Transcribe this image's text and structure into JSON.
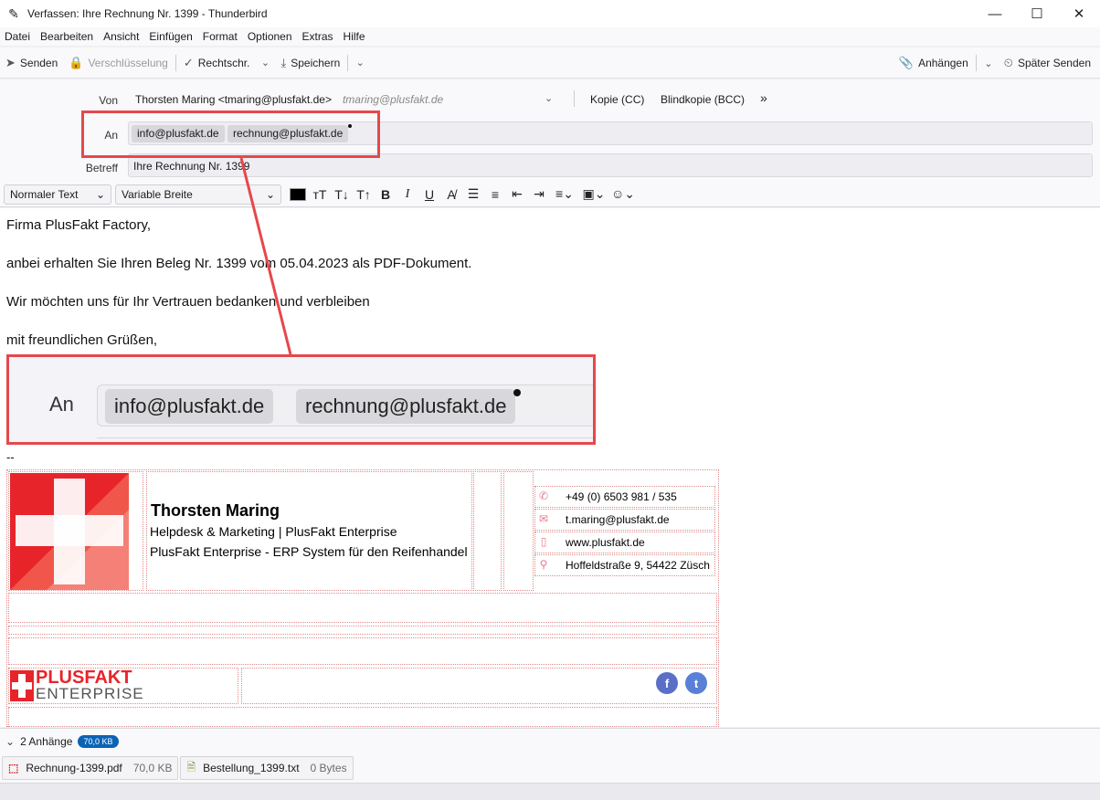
{
  "window": {
    "title": "Verfassen: Ihre Rechnung Nr. 1399 - Thunderbird",
    "minimize": "—",
    "maximize": "☐",
    "close": "✕"
  },
  "menu": [
    "Datei",
    "Bearbeiten",
    "Ansicht",
    "Einfügen",
    "Format",
    "Optionen",
    "Extras",
    "Hilfe"
  ],
  "toolbar": {
    "send": "Senden",
    "encryption": "Verschlüsselung",
    "spellcheck": "Rechtschr.",
    "save": "Speichern",
    "attach": "Anhängen",
    "send_later": "Später Senden"
  },
  "header": {
    "from_label": "Von",
    "from_value": "Thorsten Maring <tmaring@plusfakt.de>",
    "from_alt": "tmaring@plusfakt.de",
    "cc": "Kopie (CC)",
    "bcc": "Blindkopie (BCC)",
    "more": "»",
    "to_label": "An",
    "recipients": [
      "info@plusfakt.de",
      "rechnung@plusfakt.de"
    ],
    "subject_label": "Betreff",
    "subject": "Ihre Rechnung Nr. 1399"
  },
  "format": {
    "paragraph": "Normaler Text",
    "font": "Variable Breite"
  },
  "body": {
    "greeting": "Firma PlusFakt Factory,",
    "line1": "anbei erhalten Sie Ihren Beleg Nr. 1399 vom 05.04.2023 als PDF-Dokument.",
    "line2": "Wir möchten uns für Ihr Vertrauen bedanken und verbleiben",
    "closing": "mit freundlichen Grüßen,",
    "separator": "--"
  },
  "zoom": {
    "label": "An",
    "recipients": [
      "info@plusfakt.de",
      "rechnung@plusfakt.de"
    ]
  },
  "signature": {
    "name": "Thorsten Maring",
    "role": "Helpdesk & Marketing | PlusFakt Enterprise",
    "company": "PlusFakt Enterprise - ERP System für den Reifenhandel",
    "phone": "+49 (0) 6503 981 / 535",
    "email": "t.maring@plusfakt.de",
    "web": "www.plusfakt.de",
    "address": "Hoffeldstraße 9, 54422 Züsch",
    "logo_top": "PLUSFAKT",
    "logo_bottom": "ENTERPRISE",
    "facebook": "f",
    "twitter": "t"
  },
  "attachments": {
    "summary": "2 Anhänge",
    "total": "70,0 KB",
    "items": [
      {
        "name": "Rechnung-1399.pdf",
        "size": "70,0 KB",
        "icon": "pdf-icon"
      },
      {
        "name": "Bestellung_1399.txt",
        "size": "0 Bytes",
        "icon": "text-file-icon"
      }
    ]
  },
  "colors": {
    "highlight": "#e5484d",
    "badge": "#0b63b6",
    "logo_red": "#e8242b"
  }
}
